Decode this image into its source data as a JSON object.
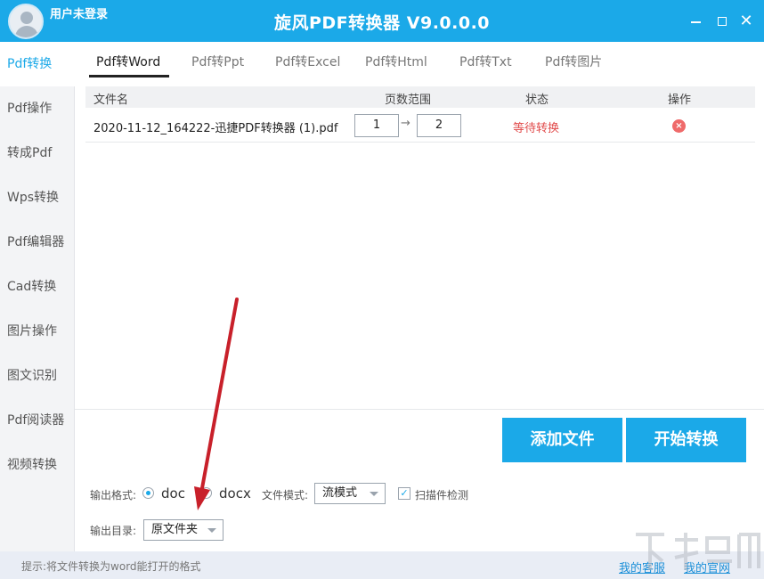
{
  "titlebar": {
    "user_label": "用户未登录",
    "app_title": "旋风PDF转换器 V9.0.0.0",
    "close_glyph": "✕"
  },
  "sidebar": {
    "items": [
      {
        "label": "Pdf转换",
        "active": true
      },
      {
        "label": "Pdf操作"
      },
      {
        "label": "转成Pdf"
      },
      {
        "label": "Wps转换"
      },
      {
        "label": "Pdf编辑器"
      },
      {
        "label": "Cad转换"
      },
      {
        "label": "图片操作"
      },
      {
        "label": "图文识别"
      },
      {
        "label": "Pdf阅读器"
      },
      {
        "label": "视频转换"
      }
    ]
  },
  "tabs": [
    {
      "label": "Pdf转Word",
      "active": true
    },
    {
      "label": "Pdf转Ppt"
    },
    {
      "label": "Pdf转Excel"
    },
    {
      "label": "Pdf转Html"
    },
    {
      "label": "Pdf转Txt"
    },
    {
      "label": "Pdf转图片"
    }
  ],
  "table": {
    "headers": {
      "file_name": "文件名",
      "page_range": "页数范围",
      "status": "状态",
      "action": "操作"
    },
    "rows": [
      {
        "file_name": "2020-11-12_164222-迅捷PDF转换器 (1).pdf",
        "page_from": "1",
        "page_to": "2",
        "arrow": "→",
        "status": "等待转换"
      }
    ]
  },
  "actions": {
    "add_file": "添加文件",
    "start_convert": "开始转换"
  },
  "options": {
    "format_label": "输出格式:",
    "format_options": [
      "doc",
      "docx"
    ],
    "format_selected": "doc",
    "mode_label": "文件模式:",
    "mode_value": "流模式",
    "scan_check_label": "扫描件检测",
    "scan_check_checked": true,
    "output_dir_label": "输出目录:",
    "output_dir_value": "原文件夹"
  },
  "statusbar": {
    "tip": "提示:将文件转换为word能打开的格式",
    "support_link": "我的客服",
    "website_link": "我的官网"
  },
  "colors": {
    "accent": "#1ba9e8",
    "status_waiting": "#e14b4b",
    "annotation_arrow": "#c8202a"
  }
}
